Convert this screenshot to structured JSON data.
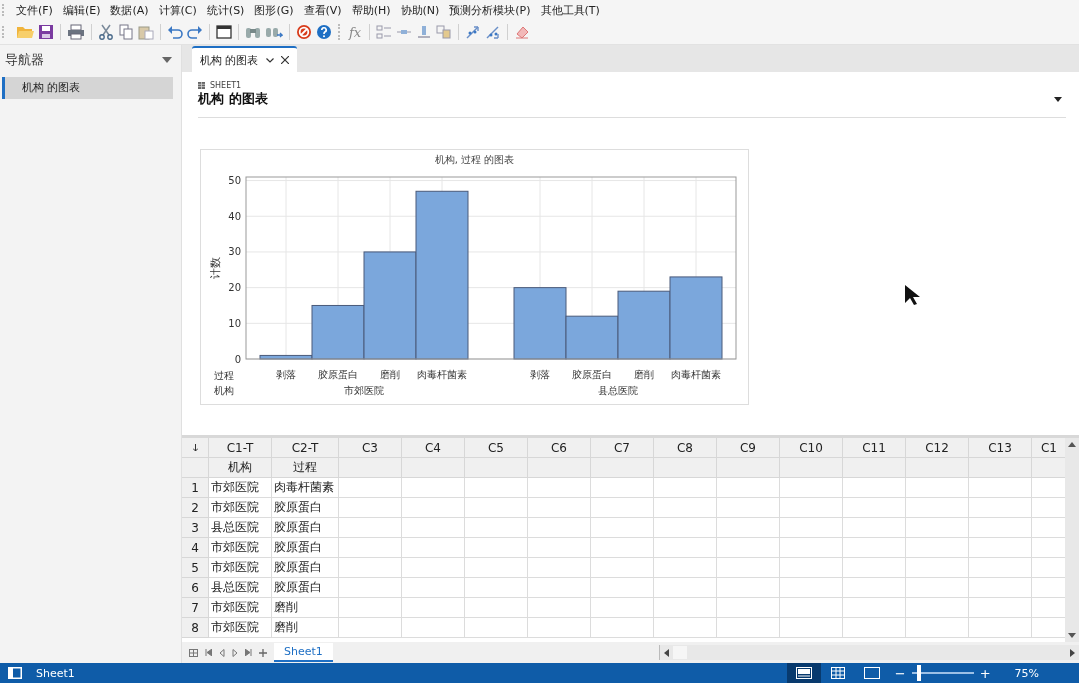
{
  "menu": [
    "文件(F)",
    "编辑(E)",
    "数据(A)",
    "计算(C)",
    "统计(S)",
    "图形(G)",
    "查看(V)",
    "帮助(H)",
    "协助(N)",
    "预测分析模块(P)",
    "其他工具(T)"
  ],
  "toolbar": {
    "formula_label": "fx"
  },
  "navigator": {
    "title": "导航器",
    "items": [
      {
        "label": "机构 的图表",
        "selected": true
      }
    ]
  },
  "tabs": [
    {
      "label": "机构 的图表",
      "selected": true
    }
  ],
  "document": {
    "sheet_label": "SHEET1",
    "title": "机构 的图表",
    "chart": {
      "row_labels": [
        "过程",
        "机构"
      ],
      "groups": [
        "市郊医院",
        "县总医院"
      ],
      "chart_data": {
        "type": "bar",
        "title": "机构, 过程 的图表",
        "ylabel": "计数",
        "categories": [
          "剥落",
          "胶原蛋白",
          "磨削",
          "肉毒杆菌素",
          "剥落",
          "胶原蛋白",
          "磨削",
          "肉毒杆菌素"
        ],
        "series": [
          {
            "color": "#7ba7dc",
            "values": [
              1,
              15,
              30,
              47,
              20,
              12,
              19,
              23
            ]
          }
        ],
        "grid": true,
        "ylim": [
          0,
          51
        ],
        "yticks": [
          0,
          10,
          20,
          30,
          40,
          50
        ]
      }
    }
  },
  "worksheet": {
    "columns": [
      {
        "name": "C1-T",
        "label": "机构"
      },
      {
        "name": "C2-T",
        "label": "过程"
      },
      {
        "name": "C3"
      },
      {
        "name": "C4"
      },
      {
        "name": "C5"
      },
      {
        "name": "C6"
      },
      {
        "name": "C7"
      },
      {
        "name": "C8"
      },
      {
        "name": "C9"
      },
      {
        "name": "C10"
      },
      {
        "name": "C11"
      },
      {
        "name": "C12"
      },
      {
        "name": "C13"
      },
      {
        "name": "C1"
      }
    ],
    "rows": [
      {
        "number": "1",
        "cells": [
          "市郊医院",
          "肉毒杆菌素"
        ]
      },
      {
        "number": "2",
        "cells": [
          "市郊医院",
          "胶原蛋白"
        ]
      },
      {
        "number": "3",
        "cells": [
          "县总医院",
          "胶原蛋白"
        ]
      },
      {
        "number": "4",
        "cells": [
          "市郊医院",
          "胶原蛋白"
        ]
      },
      {
        "number": "5",
        "cells": [
          "市郊医院",
          "胶原蛋白"
        ]
      },
      {
        "number": "6",
        "cells": [
          "县总医院",
          "胶原蛋白"
        ]
      },
      {
        "number": "7",
        "cells": [
          "市郊医院",
          "磨削"
        ]
      },
      {
        "number": "8",
        "cells": [
          "市郊医院",
          "磨削"
        ]
      }
    ],
    "sheets": [
      {
        "label": "Sheet1",
        "selected": true
      }
    ]
  },
  "status_bar": {
    "sheet": "Sheet1",
    "views": [
      {
        "kind": "page",
        "selected": true
      },
      {
        "kind": "grid",
        "selected": false
      },
      {
        "kind": "blank",
        "selected": false
      }
    ],
    "zoom_out": "−",
    "zoom_in": "+",
    "zoom": {
      "level": 0.08,
      "reading": "75%"
    }
  }
}
